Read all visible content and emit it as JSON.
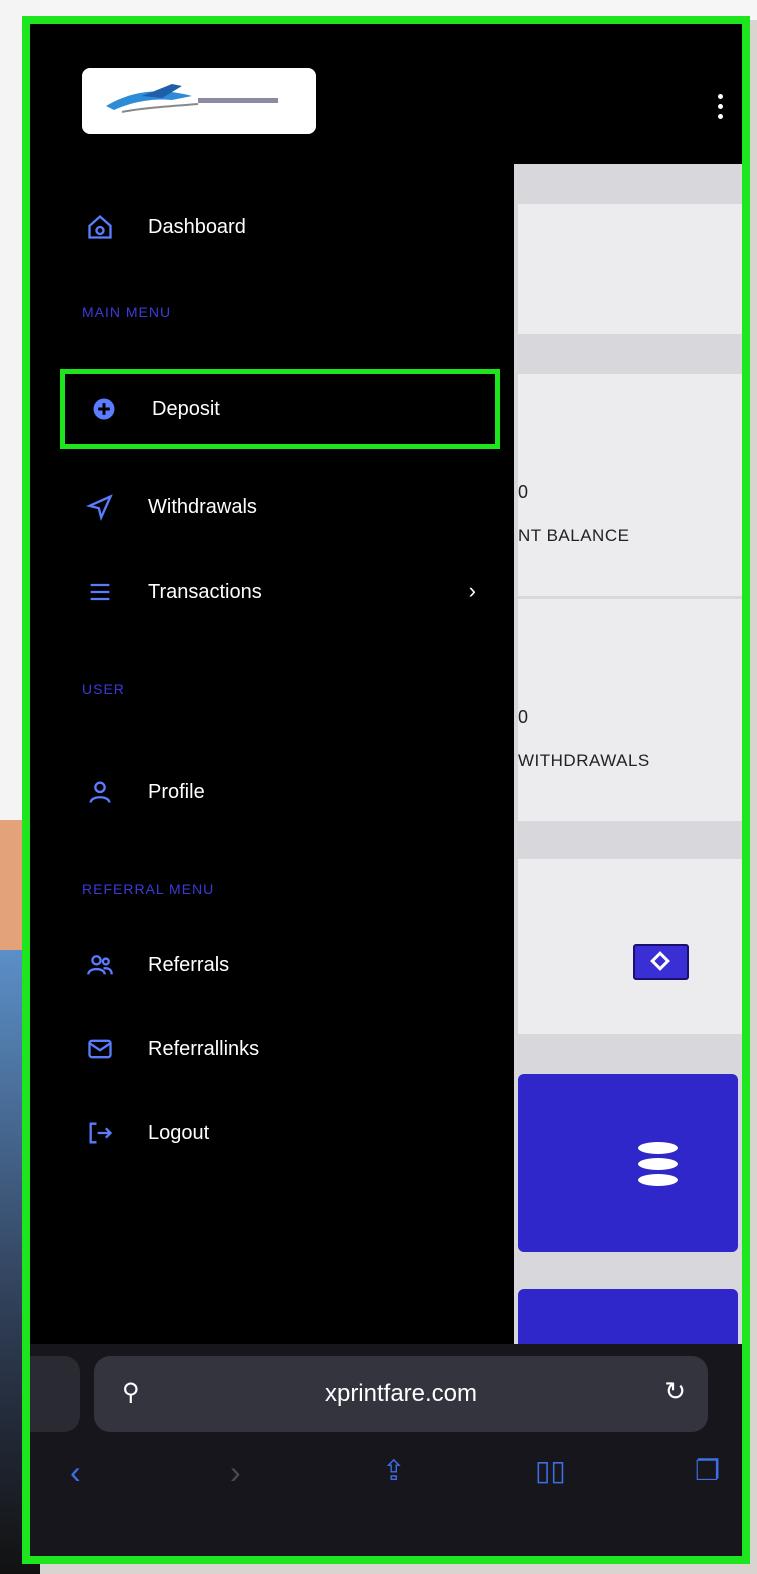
{
  "drawer": {
    "dashboard_label": "Dashboard",
    "main_menu_title": "MAIN MENU",
    "main_menu_sub": "",
    "deposit_label": "Deposit",
    "withdrawals_label": "Withdrawals",
    "transactions_label": "Transactions",
    "user_title": "USER",
    "user_sub": "",
    "profile_label": "Profile",
    "referral_title": "REFERRAL MENU",
    "referrals_label": "Referrals",
    "referral_links_label": "Referrallinks",
    "logout_label": "Logout"
  },
  "page": {
    "balance_value": "0",
    "balance_label": "NT BALANCE",
    "withdrawals_value": "0",
    "withdrawals_label": "WITHDRAWALS"
  },
  "browser": {
    "url": "xprintfare.com"
  },
  "icons": {
    "dashboard": "home-icon",
    "deposit": "deposit-icon",
    "withdrawals": "send-icon",
    "transactions": "list-icon",
    "profile": "user-icon",
    "referrals": "users-icon",
    "referral_links": "mail-icon",
    "logout": "logout-icon"
  },
  "colors": {
    "highlight": "#1ee61e",
    "accent": "#2f27c9",
    "section": "#3b3bd8"
  }
}
